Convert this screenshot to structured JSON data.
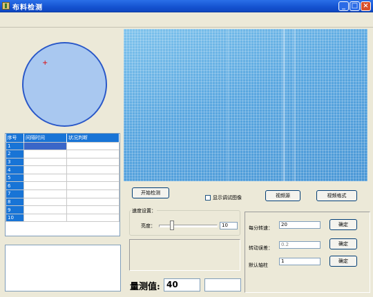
{
  "window": {
    "title": "布料检测",
    "min": "_",
    "max": "□",
    "close": "×"
  },
  "circle": {
    "marker": "+"
  },
  "table": {
    "headers": [
      "序号",
      "间隔时间",
      "状况判断"
    ],
    "rows": [
      "1",
      "2",
      "3",
      "4",
      "5",
      "6",
      "7",
      "8",
      "9",
      "10"
    ]
  },
  "controls": {
    "start_button": "开始检测",
    "show_debug_label": "显示调试图像",
    "video_source_button": "视频源",
    "video_format_button": "视频格式"
  },
  "speed_group": {
    "title": "速度设置：",
    "brightness_label": "亮度：",
    "brightness_value": "10",
    "slider_level": 0.2
  },
  "right_panel": {
    "rpm_label": "每分转速：",
    "rpm_value": "20",
    "error_label": "转动误差：",
    "error_value": "0.2",
    "default_shaft_label": "默认轴柱",
    "default_shaft_value": "1",
    "confirm": "确定"
  },
  "measurement": {
    "label": "量测值:",
    "value": "40"
  },
  "colors": {
    "titlebar": "#1452d0",
    "selection": "#1874d6",
    "circle_fill": "#a9c8f0",
    "circle_border": "#2a58c8"
  }
}
